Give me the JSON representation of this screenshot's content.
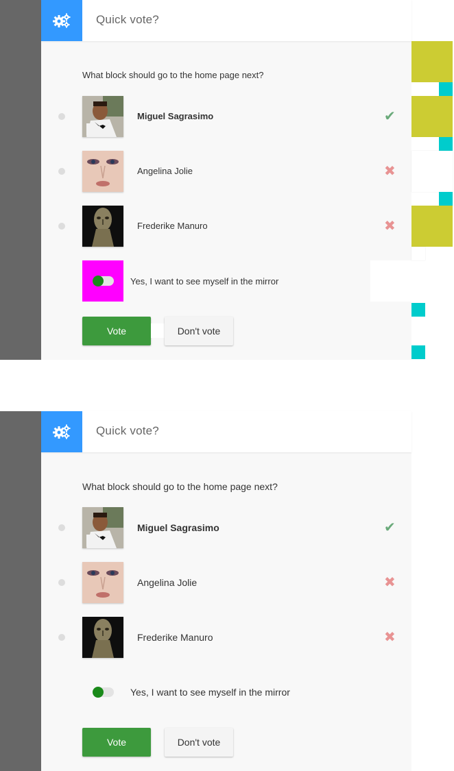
{
  "colors": {
    "rail": "#676767",
    "header_icon_bg": "#3399ff",
    "vote_button": "#3d9a3d",
    "toggle_on": "#1a8a1a",
    "check": "#6aaa7a",
    "cross": "#e89393",
    "debug_magenta": "#ff00ff",
    "debug_yellow": "#cccc33",
    "debug_cyan": "#00cccc"
  },
  "widgets": [
    {
      "header": {
        "title": "Quick vote?",
        "icon": "gears-icon"
      },
      "question": "What block should go to the home page next?",
      "options": [
        {
          "name": "Miguel Sagrasimo",
          "status": "check-icon",
          "selected_style": "bold"
        },
        {
          "name": "Angelina Jolie",
          "status": "cross-icon"
        },
        {
          "name": "Frederike Manuro",
          "status": "cross-icon"
        }
      ],
      "toggle": {
        "label": "Yes, I want to see myself in the mirror",
        "on": true
      },
      "buttons": {
        "vote": "Vote",
        "dont_vote": "Don't vote"
      }
    },
    {
      "header": {
        "title": "Quick vote?",
        "icon": "gears-icon"
      },
      "question": "What block should go to the home page next?",
      "options": [
        {
          "name": "Miguel Sagrasimo",
          "status": "check-icon",
          "selected_style": "bold"
        },
        {
          "name": "Angelina Jolie",
          "status": "cross-icon"
        },
        {
          "name": "Frederike Manuro",
          "status": "cross-icon"
        }
      ],
      "toggle": {
        "label": "Yes, I want to see myself in the mirror",
        "on": true
      },
      "buttons": {
        "vote": "Vote",
        "dont_vote": "Don't vote"
      }
    }
  ]
}
